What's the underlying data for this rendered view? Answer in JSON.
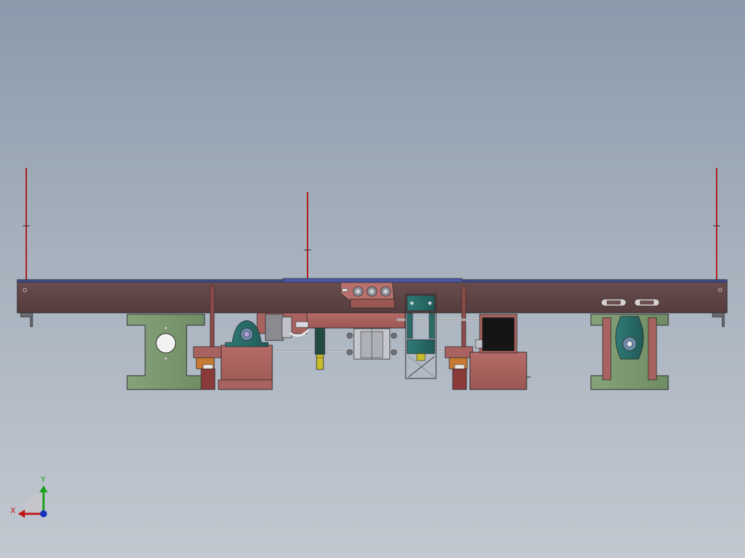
{
  "viewport": {
    "background_top": "#8b9aac",
    "background_bottom": "#c2c8d0",
    "view": "front"
  },
  "colors": {
    "frame": "#5e4445",
    "frame_top_strip": "#3d4a86",
    "part_salmon": "#a8625f",
    "bracket_green": "#7c9870",
    "bearing_teal": "#2a6b68",
    "cylinder_yellow": "#c8bc28",
    "slider_orange": "#c87a34",
    "motor_black": "#151515",
    "sensor_red": "#b01818",
    "edge": "#2a2a2a"
  },
  "icons": {
    "triad": "xyz-axis-triad",
    "x_arrow": "red-arrow-left",
    "y_arrow": "green-arrow-up",
    "z_marker": "blue-dot"
  },
  "triad": {
    "x_label": "X",
    "y_label": "Y",
    "x_color": "#c01818",
    "y_color": "#18a018",
    "z_color": "#1830c0"
  }
}
